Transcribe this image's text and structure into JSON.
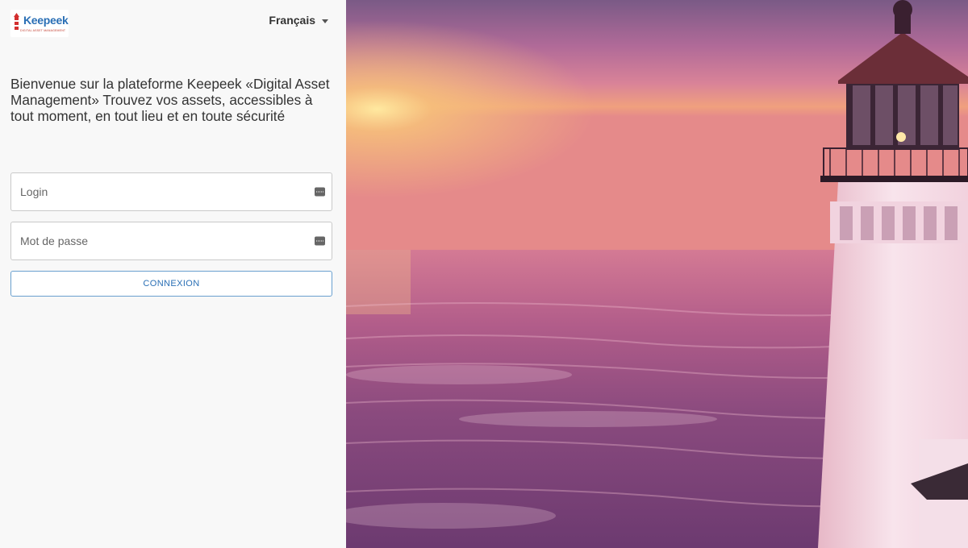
{
  "brand": {
    "logo_text": "Keepeek",
    "logo_subtext": "DIGITAL ASSET MANAGEMENT"
  },
  "language": {
    "selected": "Français"
  },
  "welcome_text": "Bienvenue sur la plateforme Keepeek «Digital Asset Management» Trouvez vos assets, accessibles à tout moment, en tout lieu et en toute sécurité",
  "form": {
    "login_placeholder": "Login",
    "password_placeholder": "Mot de passe",
    "submit_label": "CONNEXION"
  },
  "icons": {
    "field_icon": "keyboard-icon",
    "language_caret": "caret-down-icon"
  },
  "colors": {
    "accent": "#2a6fb5",
    "button_border": "#6aa0cf",
    "panel_bg": "#f8f8f8"
  }
}
